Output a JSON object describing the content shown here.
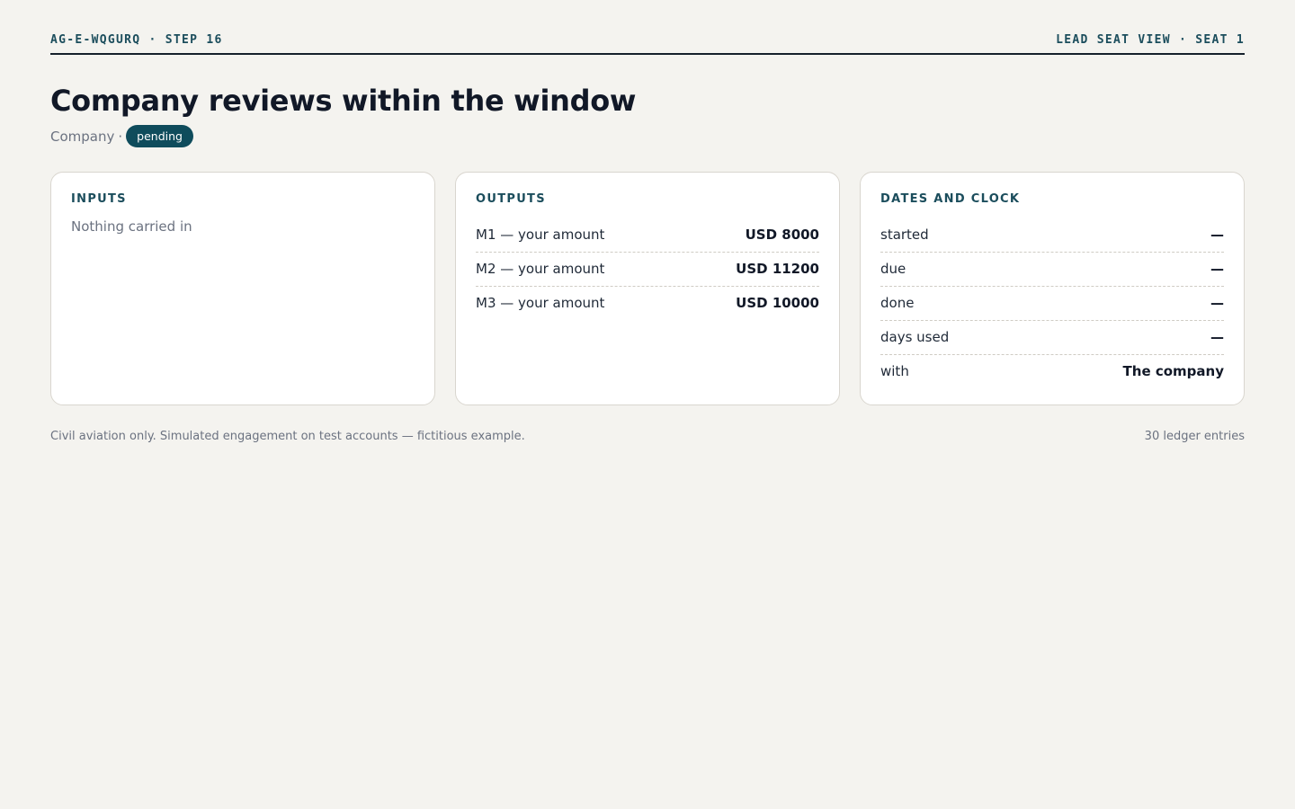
{
  "header": {
    "left": "AG-E-WQGURQ · STEP 16",
    "right": "LEAD SEAT VIEW · SEAT 1"
  },
  "title": "Company reviews within the window",
  "subline": {
    "party": "Company",
    "separator": "·",
    "status": "pending"
  },
  "cards": {
    "inputs": {
      "title": "INPUTS",
      "empty": "Nothing carried in"
    },
    "outputs": {
      "title": "OUTPUTS",
      "rows": [
        {
          "label": "M1 — your amount",
          "value": "USD 8000"
        },
        {
          "label": "M2 — your amount",
          "value": "USD 11200"
        },
        {
          "label": "M3 — your amount",
          "value": "USD 10000"
        }
      ]
    },
    "dates": {
      "title": "DATES AND CLOCK",
      "rows": [
        {
          "label": "started",
          "value": "—"
        },
        {
          "label": "due",
          "value": "—"
        },
        {
          "label": "done",
          "value": "—"
        },
        {
          "label": "days used",
          "value": "—"
        },
        {
          "label": "with",
          "value": "The company"
        }
      ]
    }
  },
  "footer": {
    "note": "Civil aviation only. Simulated engagement on test accounts — fictitious example.",
    "count": "30 ledger entries"
  },
  "colors": {
    "background": "#f4f3ef",
    "accent": "#0f4c5c",
    "heading": "#1b4d5c"
  }
}
